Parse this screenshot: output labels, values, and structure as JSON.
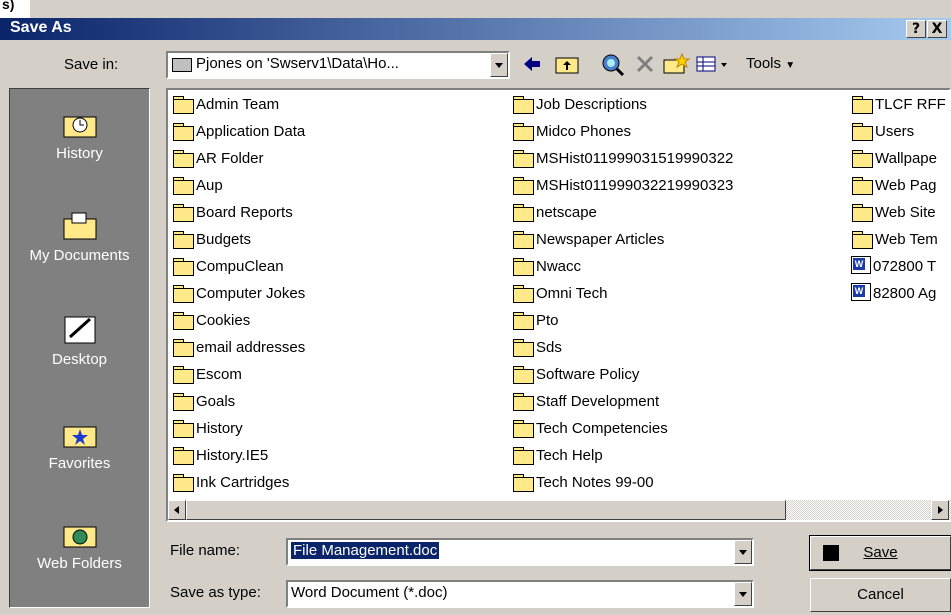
{
  "window": {
    "title": "Save As",
    "help_btn": "?",
    "close_btn": "X",
    "top_scrap": "s)"
  },
  "save_in": {
    "label": "Save in:",
    "value": "Pjones on 'Swserv1\\Data\\Ho...",
    "tools_label": "Tools"
  },
  "places": [
    {
      "label": "History"
    },
    {
      "label": "My Documents"
    },
    {
      "label": "Desktop"
    },
    {
      "label": "Favorites"
    },
    {
      "label": "Web Folders"
    }
  ],
  "files": {
    "col1": [
      "Admin Team",
      "Application Data",
      "AR Folder",
      "Aup",
      "Board Reports",
      "Budgets",
      "CompuClean",
      "Computer Jokes",
      "Cookies",
      "email addresses",
      "Escom",
      "Goals",
      "History",
      "History.IE5",
      "Ink Cartridges"
    ],
    "col2": [
      "Job Descriptions",
      "Midco Phones",
      "MSHist011999031519990322",
      "MSHist011999032219990323",
      "netscape",
      "Newspaper Articles",
      "Nwacc",
      "Omni Tech",
      "Pto",
      "Sds",
      "Software Policy",
      "Staff Development",
      "Tech Competencies",
      "Tech Help",
      "Tech Notes 99-00"
    ],
    "col3": [
      "TLCF RFF",
      "Users",
      "Wallpape",
      "Web Pag",
      "Web Site",
      "Web Tem"
    ],
    "col3_docs": [
      "072800 T",
      "82800 Ag"
    ]
  },
  "file_name": {
    "label": "File name:",
    "value": "File Management.doc"
  },
  "save_as_type": {
    "label": "Save as type:",
    "value": "Word Document (*.doc)"
  },
  "buttons": {
    "save": "Save",
    "cancel": "Cancel"
  }
}
